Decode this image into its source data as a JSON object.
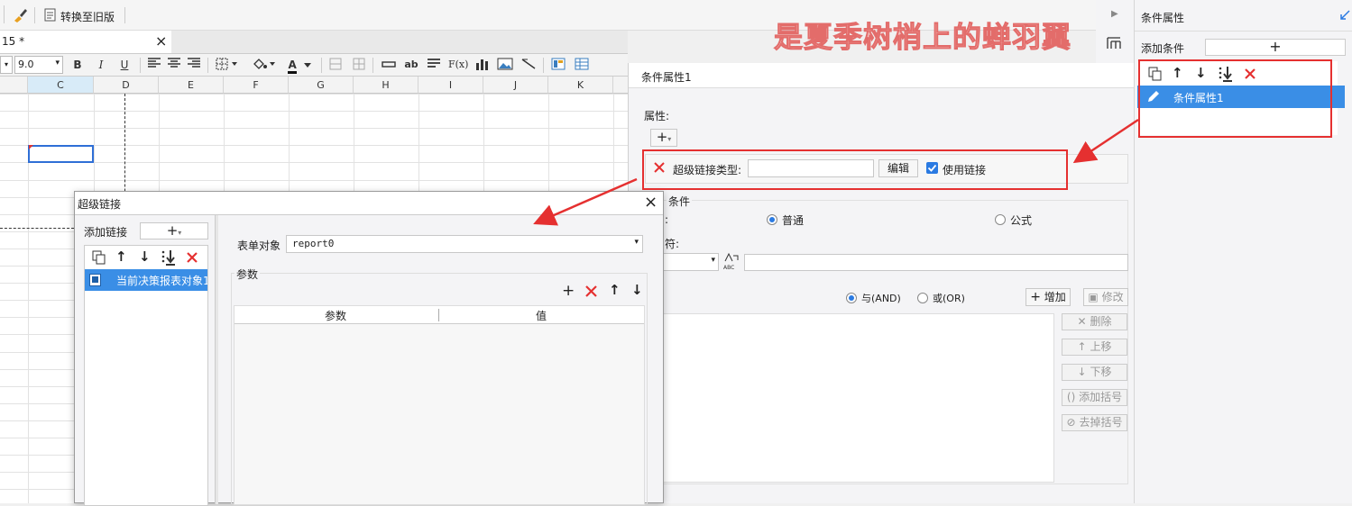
{
  "toolbar": {
    "convert_label": "转换至旧版"
  },
  "tab": {
    "title": "15 *",
    "close": "×"
  },
  "format": {
    "font_size": "9.0",
    "bold": "B",
    "italic": "I",
    "underline": "U",
    "font_color": "A",
    "text_ab": "ab",
    "fx": "F(x)"
  },
  "grid": {
    "columns": [
      "C",
      "D",
      "E",
      "F",
      "G",
      "H",
      "I",
      "J",
      "K"
    ]
  },
  "watermark": "是夏季树梢上的蝉羽翼",
  "right_panel": {
    "title": "条件属性",
    "add_condition_label": "添加条件",
    "add_symbol": "+",
    "items": [
      {
        "label": "条件属性1"
      }
    ]
  },
  "cond_panel": {
    "title": "条件属性1",
    "attr_label": "属性:",
    "add_symbol": "+",
    "hyperlink_type_label": "超级链接类型:",
    "hyperlink_type_value": "",
    "edit_label": "编辑",
    "use_link_label": "使用链接",
    "condition_label": "条件",
    "colon": ":",
    "normal_label": "普通",
    "formula_label": "公式",
    "operator_label": "符:",
    "formula_value": "",
    "and_label": "与(AND)",
    "or_label": "或(OR)",
    "add_label": "增加",
    "modify_label": "修改",
    "delete_label": "删除",
    "up_label": "上移",
    "down_label": "下移",
    "add_bracket_label": "添加括号",
    "remove_bracket_label": "去掉括号",
    "abc_glyph": "ABC"
  },
  "dialog": {
    "title": "超级链接",
    "close": "×",
    "add_link_label": "添加链接",
    "add_symbol": "+",
    "items": [
      {
        "label": "当前决策报表对象1"
      }
    ],
    "form_object_label": "表单对象",
    "form_object_value": "report0",
    "params_label": "参数",
    "col_param": "参数",
    "col_value": "值"
  }
}
